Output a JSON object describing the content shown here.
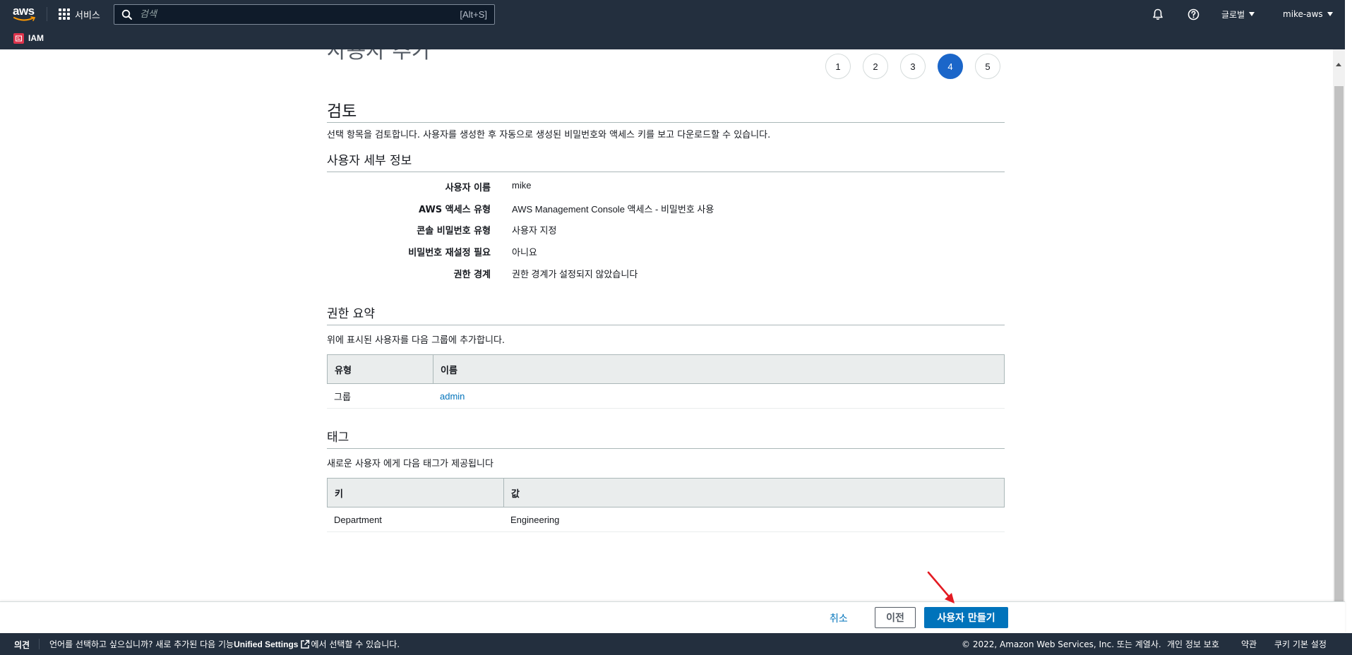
{
  "nav": {
    "logo": "aws",
    "services_label": "서비스",
    "search_placeholder": "검색",
    "search_shortcut": "[Alt+S]",
    "region_label": "글로벌",
    "account_label": "mike-aws",
    "service_name": "IAM",
    "icons": [
      "grid-icon",
      "search-icon",
      "bell-icon",
      "help-icon",
      "iam-icon"
    ]
  },
  "page": {
    "title_clipped": "사용자 추가",
    "steps": [
      "1",
      "2",
      "3",
      "4",
      "5"
    ],
    "active_step": "4"
  },
  "review": {
    "title": "검토",
    "description": "선택 항목을 검토합니다. 사용자를 생성한 후 자동으로 생성된 비밀번호와 액세스 키를 보고 다운로드할 수 있습니다."
  },
  "user_details": {
    "title": "사용자 세부 정보",
    "rows": [
      {
        "label": "사용자 이름",
        "value": "mike"
      },
      {
        "label": "AWS 액세스 유형",
        "value": "AWS Management Console 액세스 - 비밀번호 사용"
      },
      {
        "label": "콘솔 비밀번호 유형",
        "value": "사용자 지정"
      },
      {
        "label": "비밀번호 재설정 필요",
        "value": "아니요"
      },
      {
        "label": "권한 경계",
        "value": "권한 경계가 설정되지 않았습니다"
      }
    ]
  },
  "permissions": {
    "title": "권한 요약",
    "description": "위에 표시된 사용자를 다음 그룹에 추가합니다.",
    "columns": [
      "유형",
      "이름"
    ],
    "rows": [
      {
        "type": "그룹",
        "name": "admin"
      }
    ]
  },
  "tags": {
    "title": "태그",
    "description": "새로운 사용자 에게 다음 태그가 제공됩니다",
    "columns": [
      "키",
      "값"
    ],
    "rows": [
      {
        "key": "Department",
        "value": "Engineering"
      }
    ]
  },
  "actions": {
    "cancel": "취소",
    "previous": "이전",
    "create": "사용자 만들기"
  },
  "footer": {
    "feedback": "의견",
    "message_prefix": "언어를 선택하고 싶으십니까? 새로 추가된 다음 기능",
    "unified_settings": "Unified Settings",
    "message_suffix": "에서 선택할 수 있습니다.",
    "copyright": "© 2022, Amazon Web Services, Inc. 또는 계열사.",
    "privacy": "개인 정보 보호",
    "terms": "약관",
    "cookies": "쿠키 기본 설정"
  },
  "colors": {
    "nav_bg": "#232f3e",
    "primary": "#0073bb",
    "step_active": "#1b66c9",
    "annotation": "#e31b23"
  }
}
